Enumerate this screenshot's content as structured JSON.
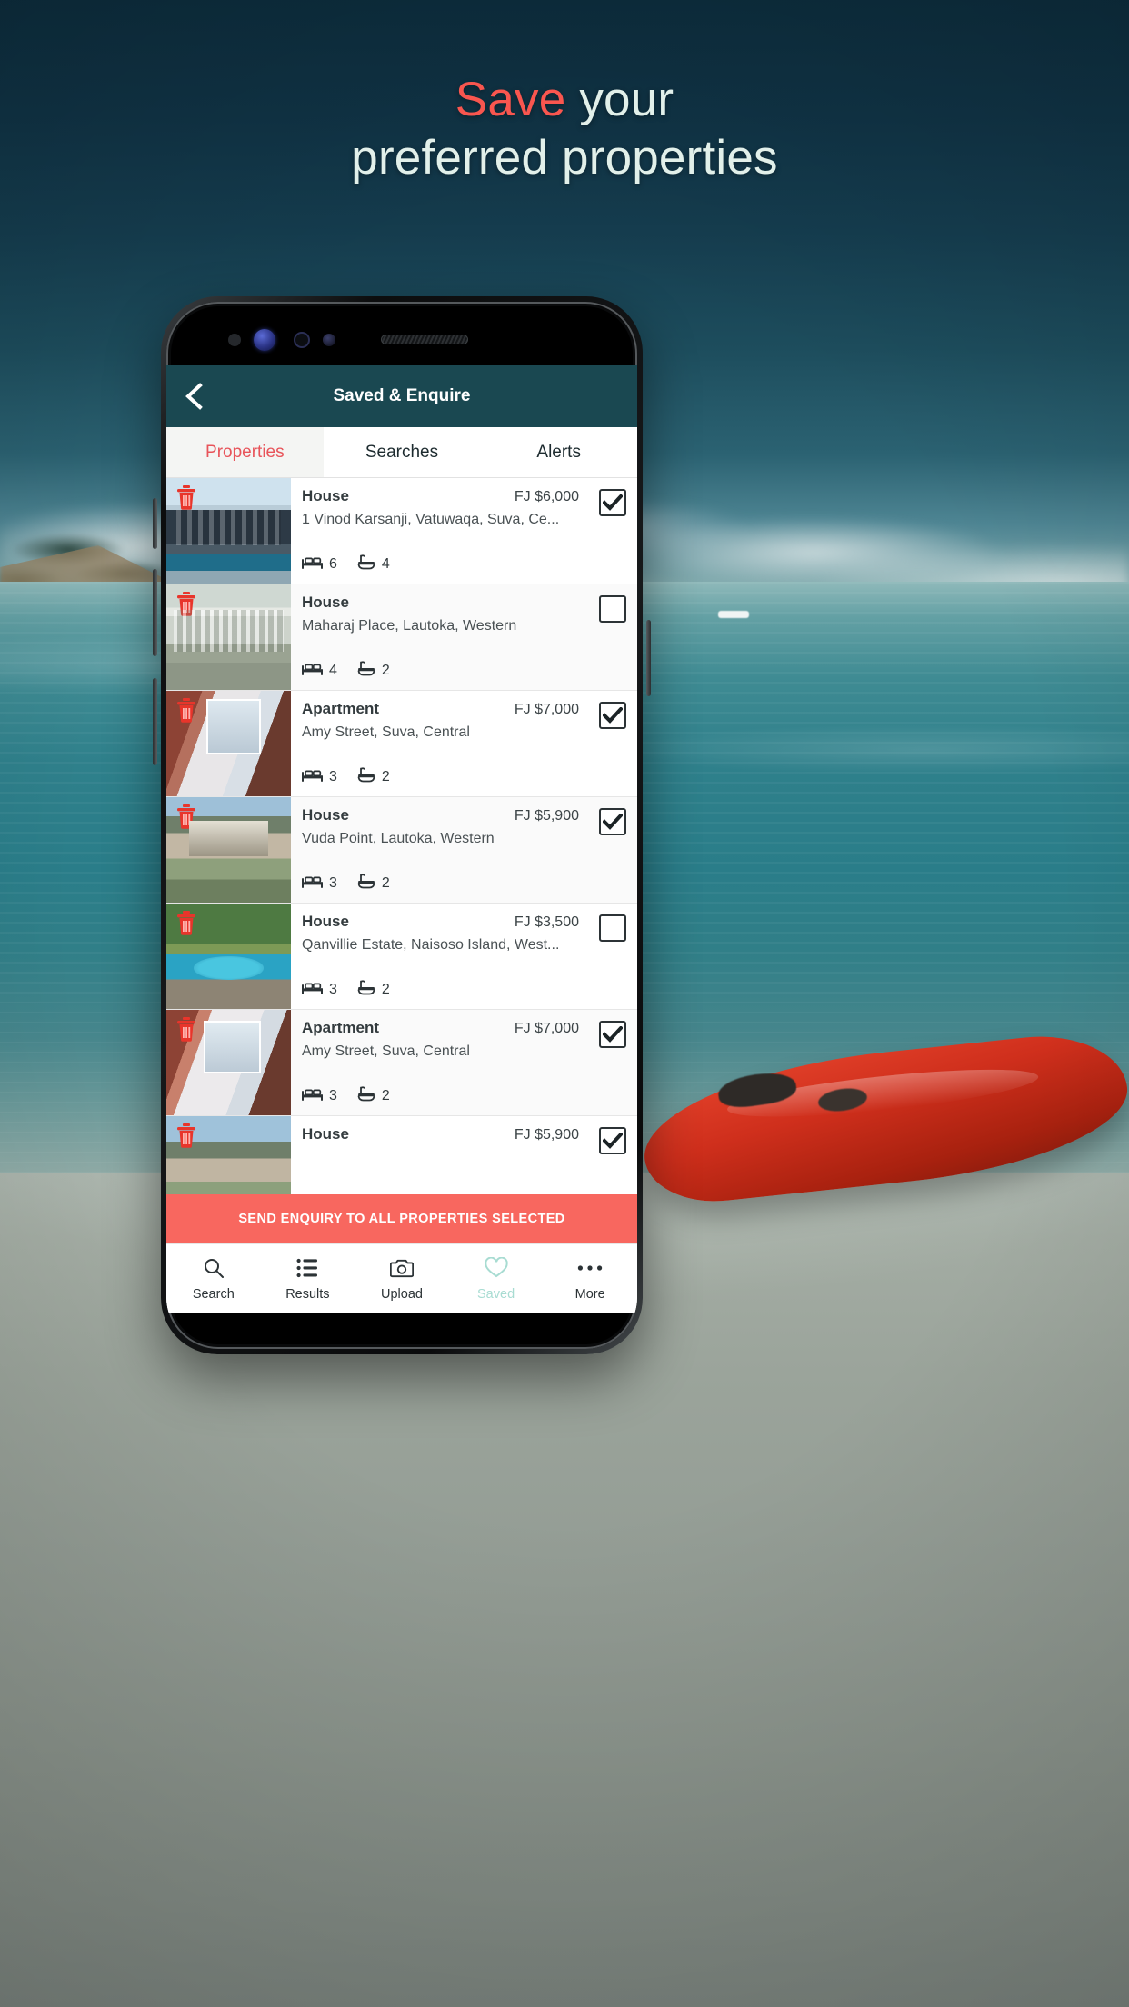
{
  "headline": {
    "line1_accent": "Save",
    "line1_rest": " your",
    "line2": "preferred properties",
    "accent_color": "#f9564f",
    "text_color": "#e2f0ea"
  },
  "appbar": {
    "title": "Saved & Enquire",
    "back_icon": "chevron-left-icon",
    "background_color": "#1a4851"
  },
  "tabs": [
    {
      "label": "Properties",
      "active": true
    },
    {
      "label": "Searches",
      "active": false
    },
    {
      "label": "Alerts",
      "active": false
    }
  ],
  "tab_active_color": "#e8545a",
  "list": {
    "delete_icon": "trash-icon",
    "bed_icon": "bed-icon",
    "bath_icon": "bath-icon",
    "checkbox_icon": "checkbox-icon",
    "items": [
      {
        "type": "House",
        "price": "FJ $6,000",
        "address": "1 Vinod Karsanji, Vatuwaqa, Suva, Ce...",
        "beds": "6",
        "baths": "4",
        "selected": true
      },
      {
        "type": "House",
        "price": "",
        "address": "Maharaj Place, Lautoka, Western",
        "beds": "4",
        "baths": "2",
        "selected": false
      },
      {
        "type": "Apartment",
        "price": "FJ $7,000",
        "address": "Amy Street, Suva, Central",
        "beds": "3",
        "baths": "2",
        "selected": true
      },
      {
        "type": "House",
        "price": "FJ $5,900",
        "address": "Vuda Point, Lautoka, Western",
        "beds": "3",
        "baths": "2",
        "selected": true
      },
      {
        "type": "House",
        "price": "FJ $3,500",
        "address": "Qanvillie Estate, Naisoso Island, West...",
        "beds": "3",
        "baths": "2",
        "selected": false
      },
      {
        "type": "Apartment",
        "price": "FJ $7,000",
        "address": "Amy Street, Suva, Central",
        "beds": "3",
        "baths": "2",
        "selected": true
      },
      {
        "type": "House",
        "price": "FJ $5,900",
        "address": "",
        "beds": "",
        "baths": "",
        "selected": true
      }
    ]
  },
  "cta": {
    "label": "SEND ENQUIRY TO ALL PROPERTIES SELECTED",
    "background_color": "#f8675f"
  },
  "bottom_nav": {
    "items": [
      {
        "label": "Search",
        "icon": "search-icon",
        "active": false
      },
      {
        "label": "Results",
        "icon": "list-icon",
        "active": false
      },
      {
        "label": "Upload",
        "icon": "camera-icon",
        "active": false
      },
      {
        "label": "Saved",
        "icon": "heart-icon",
        "active": true
      },
      {
        "label": "More",
        "icon": "ellipsis-icon",
        "active": false
      }
    ],
    "active_color": "#a8dcd2"
  }
}
